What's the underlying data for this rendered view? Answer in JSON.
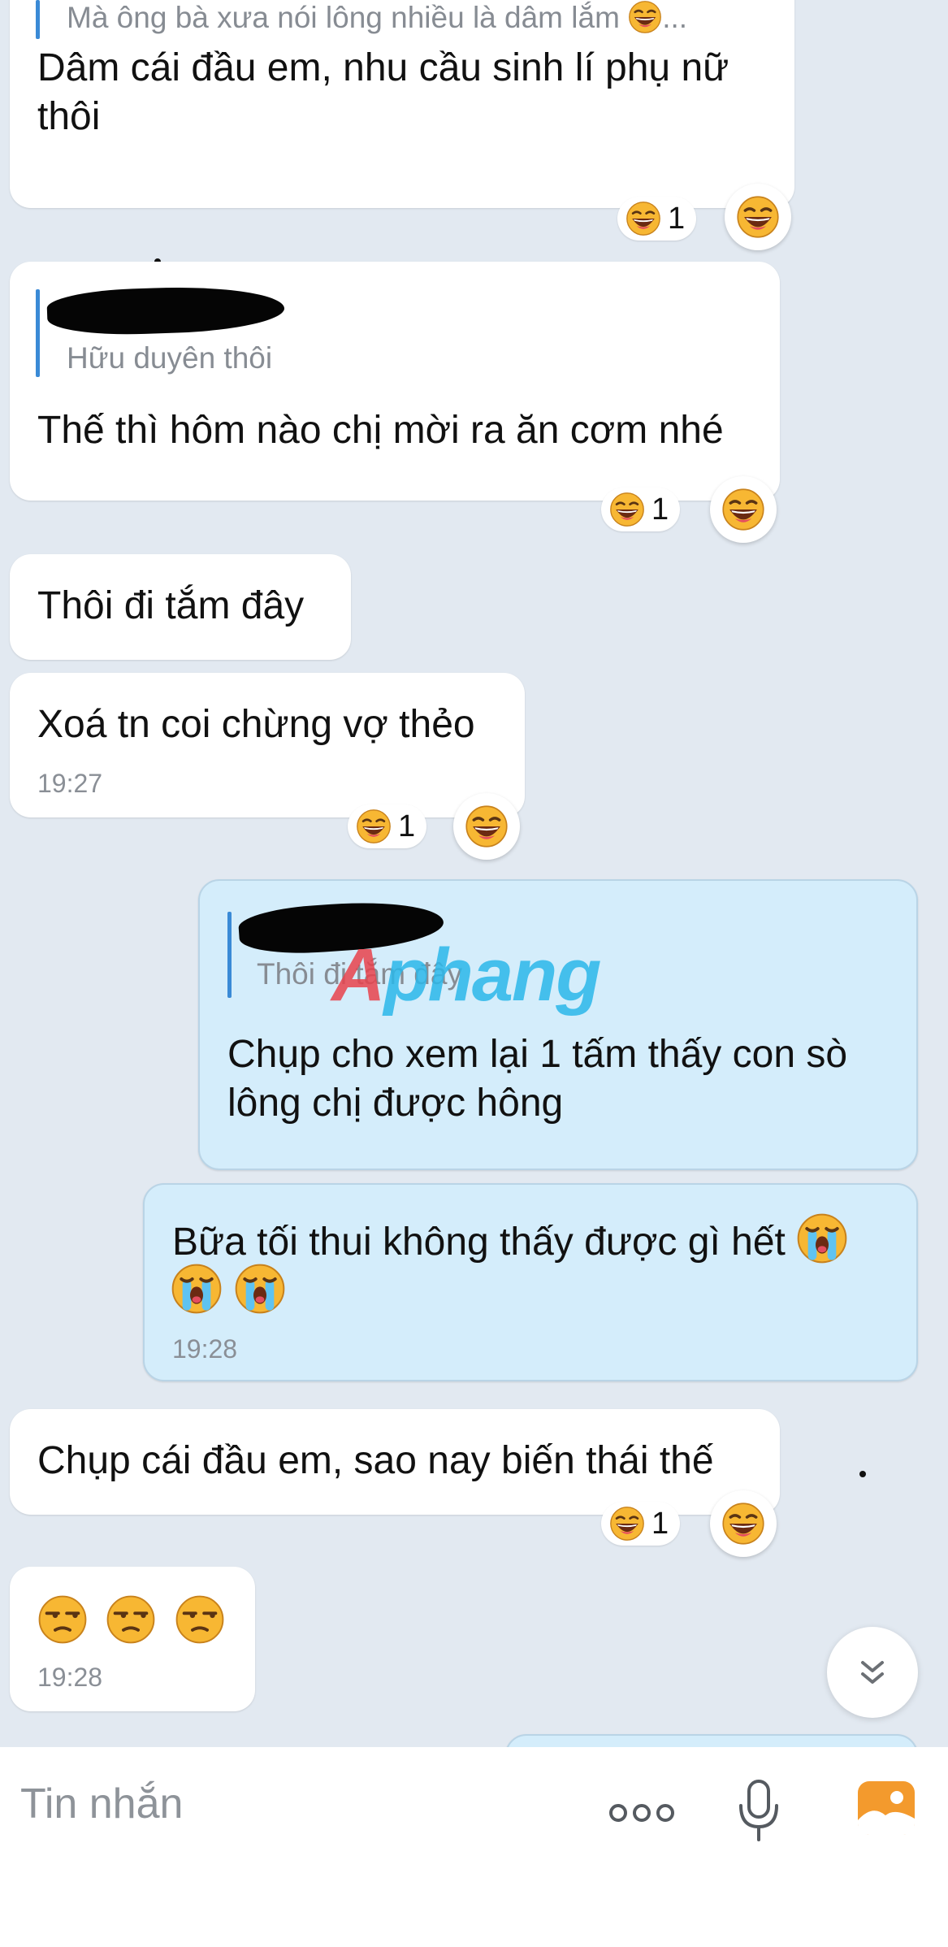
{
  "messages": {
    "m1": {
      "quote": "Mà ông bà xưa nói lông nhiều là dâm lắm",
      "quote_suffix": "...",
      "line1": "Dâm cái đầu em, nhu cầu sinh lí phụ nữ",
      "line2": "thôi",
      "reaction_count": "1"
    },
    "m2": {
      "quote": "Hữu duyên thôi",
      "line1": "Thế thì hôm nào chị mời ra ăn cơm nhé",
      "reaction_count": "1"
    },
    "m3": {
      "line1": "Thôi đi tắm đây"
    },
    "m4": {
      "line1": "Xoá tn coi chừng vợ thẻo",
      "time": "19:27",
      "reaction_count": "1"
    },
    "m5": {
      "quote": "Thôi đi tắm đây",
      "line1": "Chụp cho xem lại 1 tấm thấy con sò",
      "line2": "lông chị được hông"
    },
    "m6": {
      "line1": "Bữa tối thui không thấy được gì hết",
      "time": "19:28",
      "emoji": "crying-face"
    },
    "m7": {
      "line1": "Chụp cái đầu em, sao nay biến thái thế",
      "reaction_count": "1"
    },
    "m8": {
      "emojis": [
        "unamused-face",
        "unamused-face",
        "unamused-face"
      ],
      "time": "19:28"
    }
  },
  "watermark": {
    "text_a": "A",
    "text_b": "phang",
    "color_a": "#e8434d",
    "color_b": "#2bb8ea"
  },
  "composer": {
    "placeholder": "Tin nhắn",
    "icons": [
      "more-options-icon",
      "microphone-icon",
      "image-gallery-icon"
    ]
  },
  "colors": {
    "background": "#e2e9f1",
    "incoming_bubble": "#ffffff",
    "outgoing_bubble": "#d4edfb",
    "quote_bar": "#3a8ad6",
    "gallery_icon": "#f39a2d"
  }
}
